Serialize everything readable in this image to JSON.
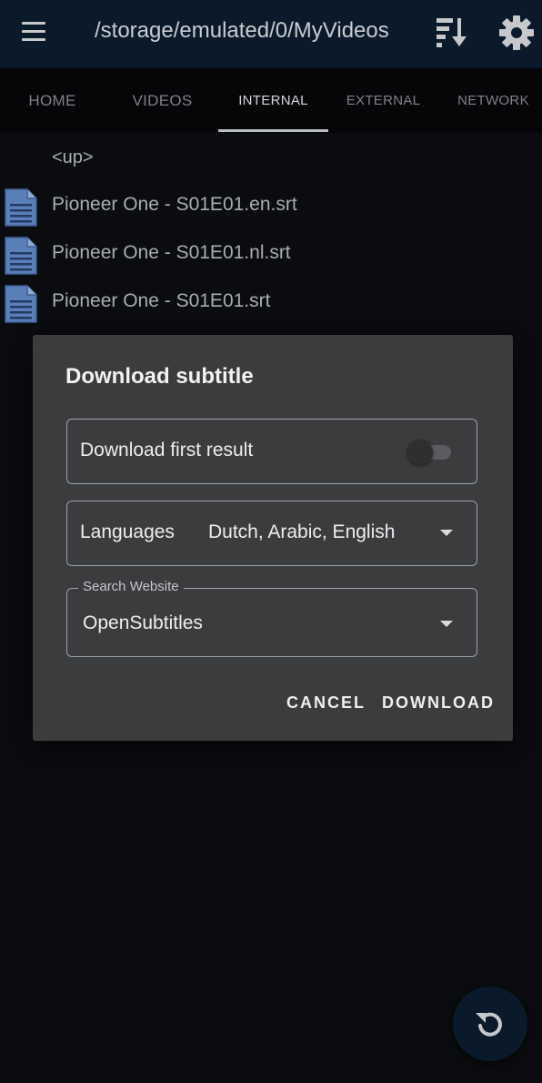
{
  "appbar": {
    "title": "/storage/emulated/0/MyVideos",
    "menu_icon": "hamburger-menu-icon",
    "sort_icon": "sort-descending-icon",
    "settings_icon": "gear-icon",
    "background": "#0a1a2b"
  },
  "tabs": {
    "items": [
      {
        "label": "HOME"
      },
      {
        "label": "VIDEOS"
      },
      {
        "label": "INTERNAL"
      },
      {
        "label": "EXTERNAL"
      },
      {
        "label": "NETWORK"
      }
    ],
    "active": "INTERNAL"
  },
  "files": {
    "up_label": "<up>",
    "items": [
      {
        "name": "Pioneer One - S01E01.en.srt",
        "icon": "document-icon"
      },
      {
        "name": "Pioneer One - S01E01.nl.srt",
        "icon": "document-icon"
      },
      {
        "name": "Pioneer One - S01E01.srt",
        "icon": "document-icon"
      }
    ]
  },
  "dialog": {
    "title": "Download subtitle",
    "first_result_label": "Download first result",
    "first_result_enabled": false,
    "languages_label": "Languages",
    "languages_value": "Dutch, Arabic, English",
    "search_website_label": "Search Website",
    "search_website_value": "OpenSubtitles",
    "cancel_label": "CANCEL",
    "download_label": "DOWNLOAD"
  },
  "fab": {
    "icon": "refresh-icon"
  },
  "colors": {
    "background": "#0b0c0f",
    "dialog": "#3b3c3e",
    "accent_primary": "#0a1a2b",
    "file_icon": "#5b7fb8"
  }
}
